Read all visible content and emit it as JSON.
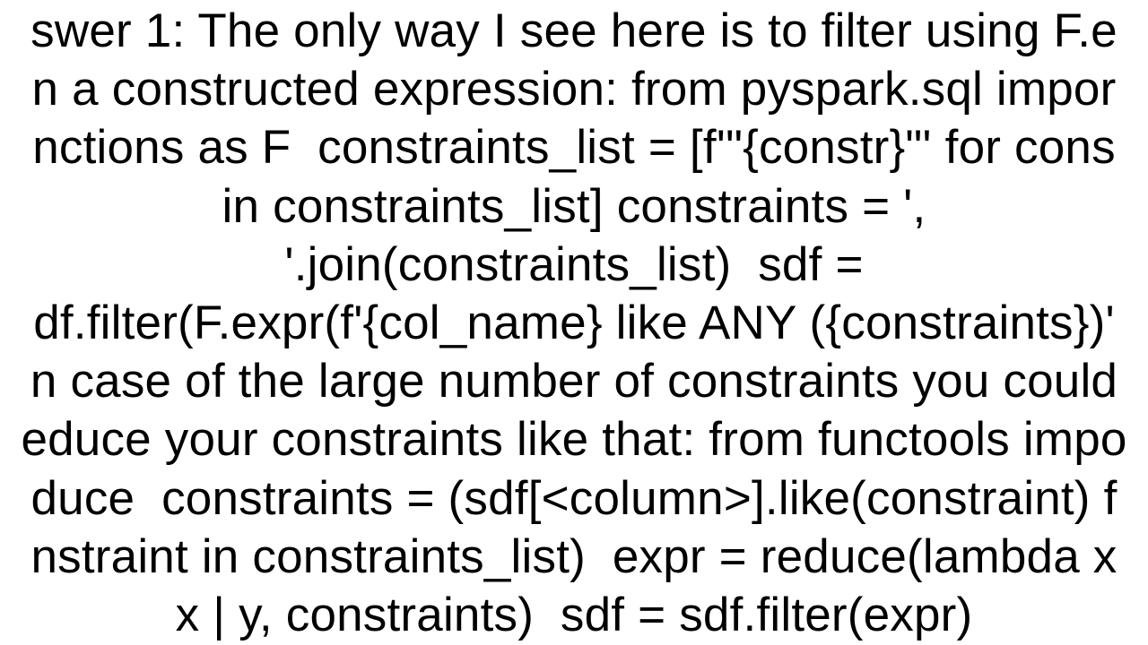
{
  "answer": {
    "text": "swer 1: The only way I see here is to filter using F.e\nn a constructed expression: from pyspark.sql impor\nnctions as F  constraints_list = [f'\"{constr}\"' for cons\nin constraints_list] constraints = ',\n'.join(constraints_list)  sdf =\ndf.filter(F.expr(f'{col_name} like ANY ({constraints})'\nn case of the large number of constraints you could\neduce your constraints like that: from functools impo\nduce  constraints = (sdf[<column>].like(constraint) f\nnstraint in constraints_list)  expr = reduce(lambda x\nx | y, constraints)  sdf = sdf.filter(expr)"
  }
}
